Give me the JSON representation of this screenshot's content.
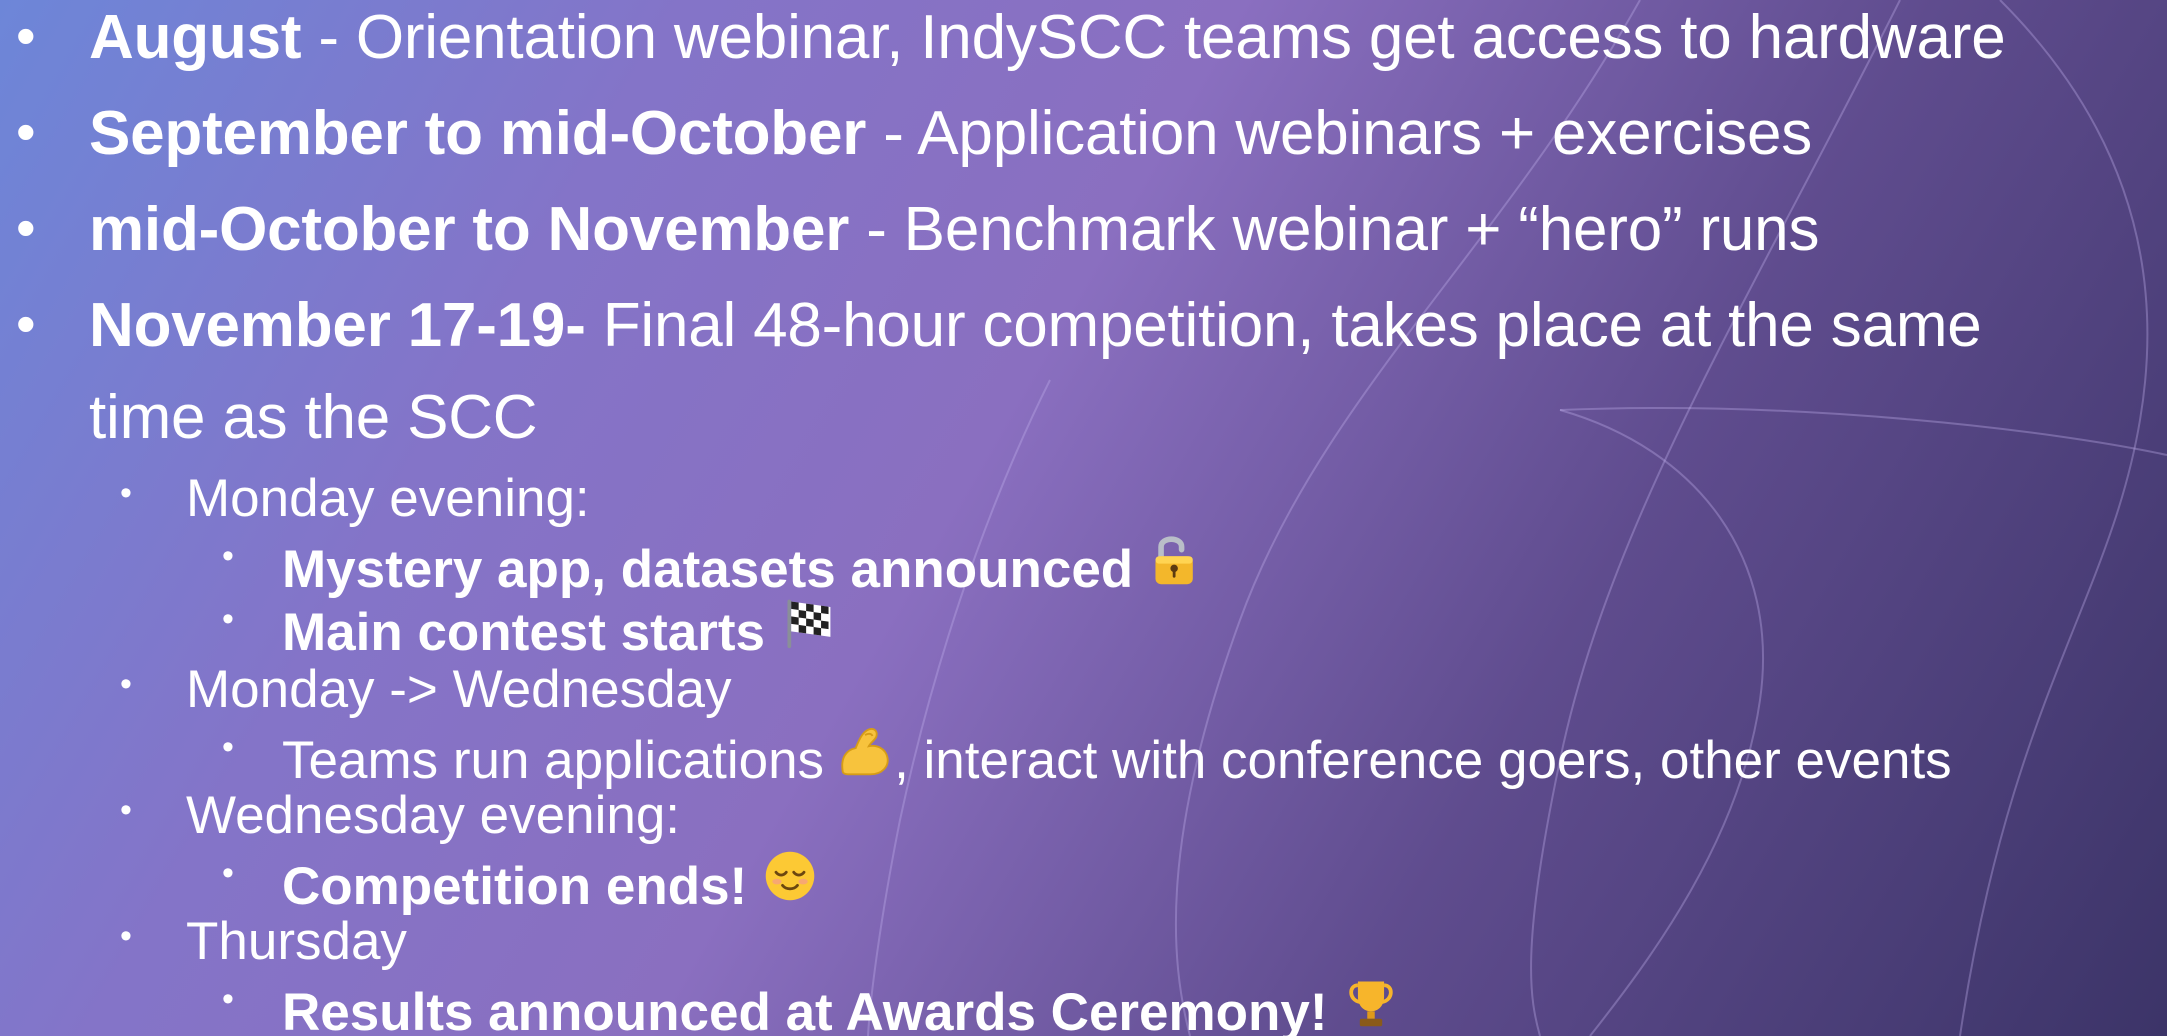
{
  "items": [
    {
      "bold": "August",
      "text": " - Orientation webinar, IndySCC teams get access to hardware"
    },
    {
      "bold": "September to mid-October",
      "text": " - Application webinars + exercises"
    },
    {
      "bold": "mid-October to November",
      "text": " - Benchmark webinar + “hero” runs"
    },
    {
      "bold": "November 17-19-",
      "text": " Final 48-hour competition, takes place at the same",
      "continuation": "time as the SCC"
    }
  ],
  "sub_items": {
    "monday_evening": "Monday evening:",
    "mystery_app": "Mystery app, datasets announced",
    "main_contest": "Main contest starts",
    "monday_wednesday": "Monday -> Wednesday",
    "teams_run_a": "Teams run applications",
    "teams_run_b": ", interact with conference goers, other events",
    "wednesday_evening": "Wednesday evening:",
    "competition_ends": "Competition ends!",
    "thursday": "Thursday",
    "results": "Results announced at Awards Ceremony!"
  },
  "bullet_char": "•",
  "colors": {
    "text": "#ffffff",
    "bg_start": "#6d86d8",
    "bg_end": "#3c3468"
  },
  "icons": [
    "unlocked-padlock-icon",
    "checkered-flag-icon",
    "flexed-biceps-icon",
    "relieved-face-icon",
    "trophy-icon"
  ]
}
